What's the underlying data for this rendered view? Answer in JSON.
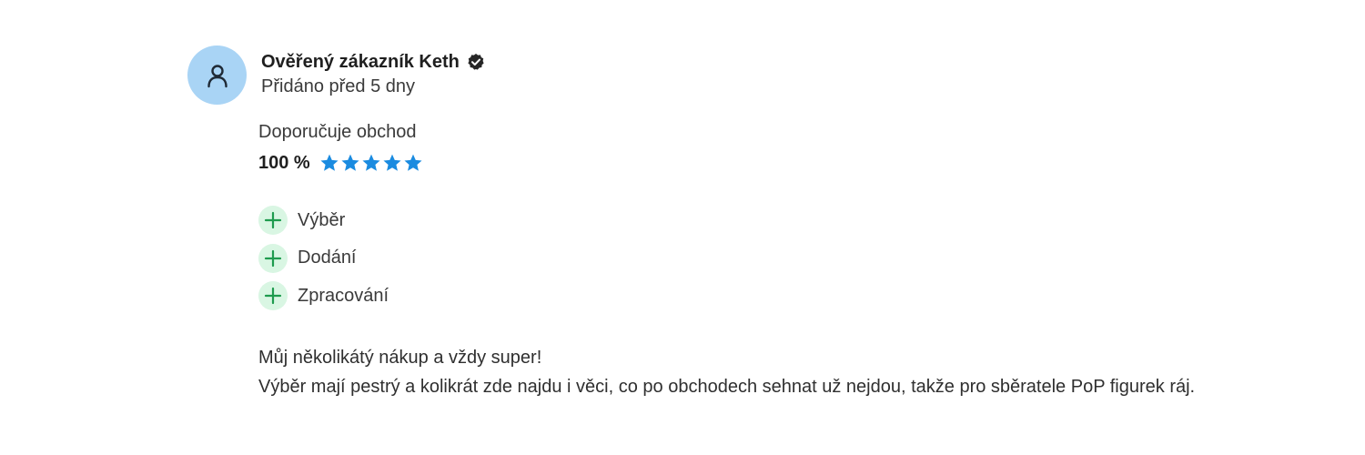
{
  "review": {
    "author_name": "Ověřený zákazník Keth",
    "added": "Přidáno před 5 dny",
    "recommend_label": "Doporučuje obchod",
    "rating_percent": "100 %",
    "stars_filled": 5,
    "stars_total": 5,
    "pros": [
      {
        "label": "Výběr"
      },
      {
        "label": "Dodání"
      },
      {
        "label": "Zpracování"
      }
    ],
    "comment_lines": [
      "Můj několikátý nákup a vždy super!",
      "Výběr mají pestrý a kolikrát zde najdu i věci, co po obchodech sehnat už nejdou, takže pro sběratele PoP figurek ráj."
    ]
  },
  "icons": {
    "avatar": "user-icon",
    "verified": "verified-check-icon",
    "star": "star-icon",
    "pro": "plus-icon"
  },
  "colors": {
    "avatar_bg": "#a9d4f5",
    "star": "#1a8be0",
    "plus_bg": "#d9f6e3",
    "plus": "#1e9b4e",
    "text": "#2b2b2b"
  }
}
